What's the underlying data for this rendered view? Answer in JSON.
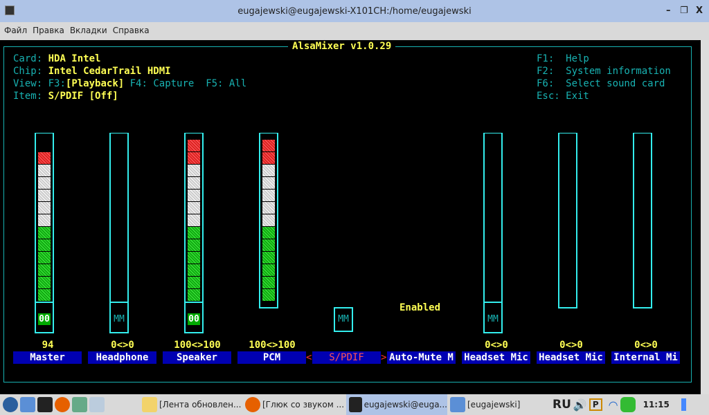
{
  "window": {
    "title": "eugajewski@eugajewski-X101CH:/home/eugajewski",
    "minimize": "–",
    "restore": "❐",
    "close": "X"
  },
  "menu": [
    "Файл",
    "Правка",
    "Вкладки",
    "Справка"
  ],
  "alsamixer": {
    "title": "AlsaMixer v1.0.29",
    "card_label": "Card:",
    "card": "HDA Intel",
    "chip_label": "Chip:",
    "chip": "Intel CedarTrail HDMI",
    "view_label": "View:",
    "view_f3": "F3:",
    "view_playback": "[Playback]",
    "view_rest": " F4: Capture  F5: All",
    "item_label": "Item:",
    "item": "S/PDIF [Off]",
    "help": [
      "F1:  Help",
      "F2:  System information",
      "F6:  Select sound card",
      "Esc: Exit"
    ],
    "enabled": "Enabled",
    "sel_left": "<",
    "sel_right": ">",
    "channels": [
      {
        "name": "Master",
        "value": "94",
        "level": 94,
        "meter": true,
        "switch": "00",
        "switch_on": true
      },
      {
        "name": "Headphone",
        "value": "0<>0",
        "level": 0,
        "meter": true,
        "switch": "MM",
        "switch_on": false
      },
      {
        "name": "Speaker",
        "value": "100<>100",
        "level": 100,
        "meter": true,
        "switch": "00",
        "switch_on": true
      },
      {
        "name": "PCM",
        "value": "100<>100",
        "level": 100,
        "meter": true,
        "switch": null
      },
      {
        "name": "S/PDIF",
        "value": "",
        "meter": false,
        "switch": "MM",
        "switch_on": false,
        "selected": true
      },
      {
        "name": "Auto-Mute M",
        "value": "",
        "meter": false,
        "switch": null
      },
      {
        "name": "Headset Mic",
        "value": "0<>0",
        "level": 0,
        "meter": true,
        "switch": "MM",
        "switch_on": false
      },
      {
        "name": "Headset Mic",
        "value": "0<>0",
        "level": 0,
        "meter": true,
        "switch": null
      },
      {
        "name": "Internal Mi",
        "value": "0<>0",
        "level": 0,
        "meter": true,
        "switch": null
      }
    ]
  },
  "taskbar": {
    "tasks": [
      "[Лента обновлен...",
      "[Глюк со звуком ...",
      "eugajewski@euga...",
      "[eugajewski]"
    ],
    "lang": "RU",
    "clock": "11:15",
    "tray_p": "P"
  }
}
